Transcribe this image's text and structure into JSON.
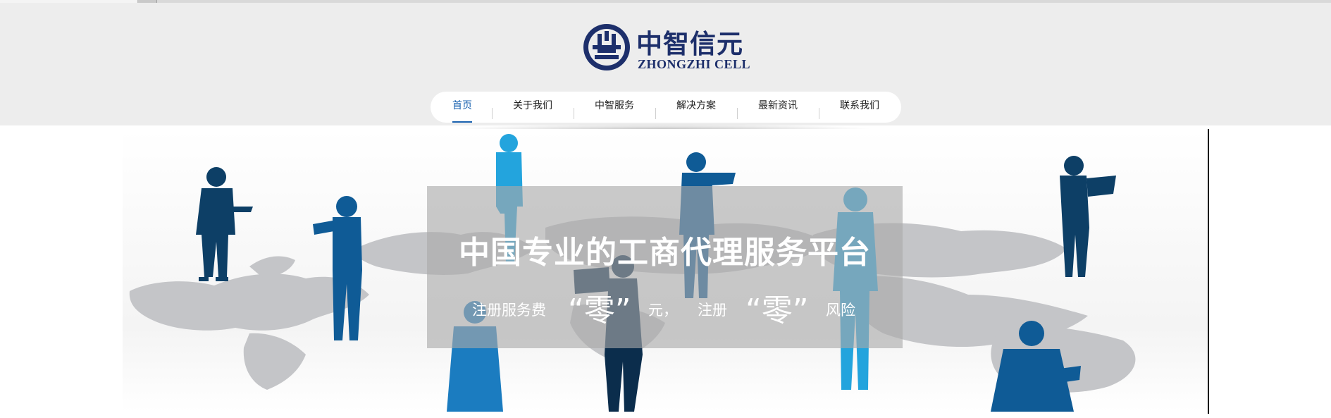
{
  "brand": {
    "name_cn": "中智信元",
    "name_en": "ZHONGZHI CELL",
    "color": "#1d2f6b"
  },
  "nav": {
    "items": [
      {
        "label": "首页",
        "active": true
      },
      {
        "label": "关于我们",
        "active": false
      },
      {
        "label": "中智服务",
        "active": false
      },
      {
        "label": "解决方案",
        "active": false
      },
      {
        "label": "最新资讯",
        "active": false
      },
      {
        "label": "联系我们",
        "active": false
      }
    ],
    "active_color": "#1b63b0"
  },
  "banner": {
    "headline": "中国专业的工商代理服务平台",
    "subline": {
      "part1": "注册服务费",
      "quote1": "“零”",
      "part2": "元，",
      "part3": "注册",
      "quote2": "“零”",
      "part4": "风险"
    },
    "image": "business-people-silhouettes-on-world-map"
  }
}
